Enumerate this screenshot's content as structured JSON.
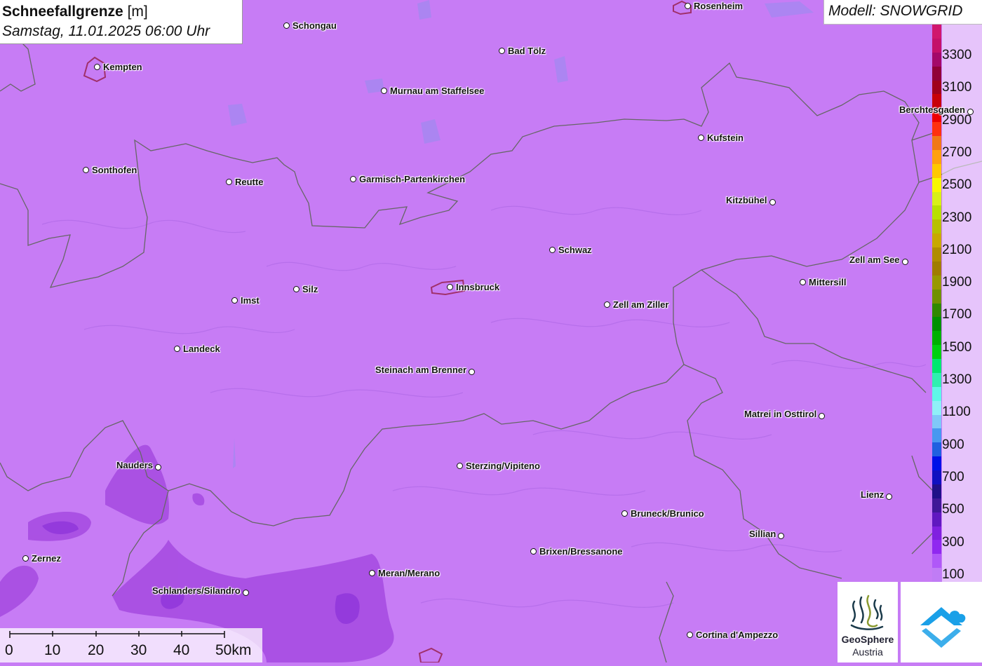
{
  "title": {
    "variable": "Schneefallgrenze",
    "unit": "[m]",
    "date": "Samstag, 11.01.2025 06:00 Uhr"
  },
  "model": "Modell: SNOWGRID",
  "legend": {
    "labels": [
      "3300",
      "3100",
      "2900",
      "2700",
      "2500",
      "2300",
      "2100",
      "1900",
      "1700",
      "1500",
      "1300",
      "1100",
      "900",
      "700",
      "500",
      "300",
      "100"
    ],
    "colors": [
      "#d0176d",
      "#c4106a",
      "#a4086a",
      "#900038",
      "#a0001c",
      "#c80008",
      "#ec0000",
      "#ff3010",
      "#f07818",
      "#ffa010",
      "#ffc800",
      "#f8f800",
      "#d8f018",
      "#b8e000",
      "#b8c000",
      "#c8a800",
      "#b08c00",
      "#a07c00",
      "#989800",
      "#709000",
      "#308800",
      "#009000",
      "#00b000",
      "#00d010",
      "#00e870",
      "#30f0b0",
      "#60f8e8",
      "#90f0f8",
      "#80c8f8",
      "#4898f0",
      "#2060e0",
      "#0010e8",
      "#1010c0",
      "#201088",
      "#401898",
      "#6018c0",
      "#8020e0",
      "#9028f0",
      "#b058f8",
      "#c07cf5"
    ]
  },
  "scalebar": {
    "labels": [
      "0",
      "10",
      "20",
      "30",
      "40",
      "50km"
    ]
  },
  "logos": {
    "geosphere_line1": "GeoSphere",
    "geosphere_line2": "Austria"
  },
  "towns": [
    {
      "name": "Rosenheim"
    },
    {
      "name": "Schongau"
    },
    {
      "name": "Bad Tölz"
    },
    {
      "name": "Kempten"
    },
    {
      "name": "Murnau am Staffelsee"
    },
    {
      "name": "Berchtesgaden"
    },
    {
      "name": "Kufstein"
    },
    {
      "name": "Sonthofen"
    },
    {
      "name": "Reutte"
    },
    {
      "name": "Garmisch-Partenkirchen"
    },
    {
      "name": "Kitzbühel"
    },
    {
      "name": "Schwaz"
    },
    {
      "name": "Zell am See"
    },
    {
      "name": "Mittersill"
    },
    {
      "name": "Innsbruck"
    },
    {
      "name": "Silz"
    },
    {
      "name": "Imst"
    },
    {
      "name": "Zell am Ziller"
    },
    {
      "name": "Landeck"
    },
    {
      "name": "Steinach am Brenner"
    },
    {
      "name": "Matrei in Osttirol"
    },
    {
      "name": "Nauders"
    },
    {
      "name": "Sterzing/Vipiteno"
    },
    {
      "name": "Lienz"
    },
    {
      "name": "Bruneck/Brunico"
    },
    {
      "name": "Sillian"
    },
    {
      "name": "Brixen/Bressanone"
    },
    {
      "name": "Zernez"
    },
    {
      "name": "Meran/Merano"
    },
    {
      "name": "Schlanders/Silandro"
    },
    {
      "name": "Cortina d'Ampezzo"
    }
  ]
}
